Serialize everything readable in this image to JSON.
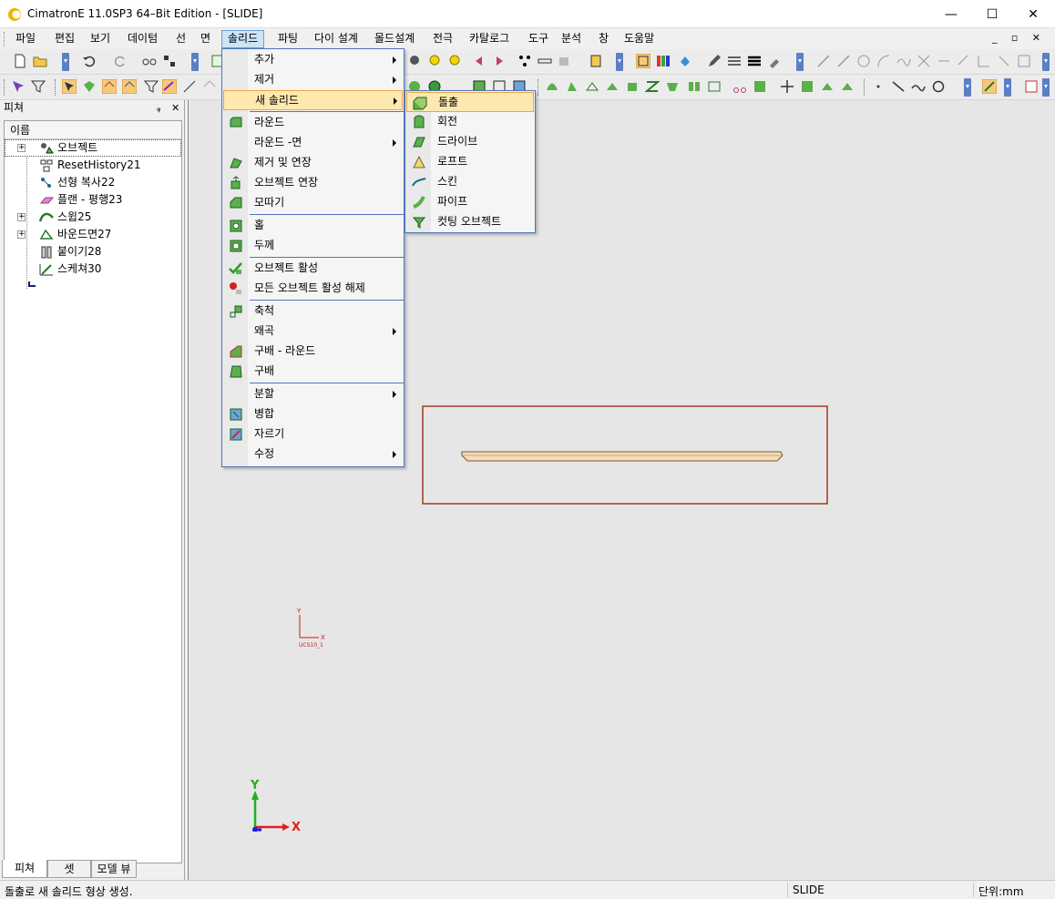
{
  "window": {
    "title": "CimatronE 11.0SP3 64–Bit Edition - [SLIDE]",
    "minimize_glyph": "—",
    "maximize_glyph": "☐",
    "close_glyph": "✕"
  },
  "menubar": {
    "items": [
      "파일",
      "편집",
      "보기",
      "데이텀",
      "선",
      "면",
      "솔리드",
      "파팅",
      "다이 설계",
      "몰드설계",
      "전극",
      "카탈로그",
      "도구",
      "분석",
      "창",
      "도움말"
    ],
    "active_index": 6,
    "mdi_controls": "_ ▫ ✕"
  },
  "feature_panel": {
    "title": "피쳐",
    "pin_glyph": "ᵩ",
    "close_glyph": "✕",
    "column_header": "이름",
    "tree": [
      {
        "label": "오브젝트",
        "expander": "+",
        "icon": "objects-icon"
      },
      {
        "label": "ResetHistory21",
        "icon": "reset-history-icon"
      },
      {
        "label": "선형 복사22",
        "icon": "linear-copy-icon"
      },
      {
        "label": "플랜 - 평행23",
        "icon": "plane-icon"
      },
      {
        "label": "스윕25",
        "expander": "+",
        "icon": "sweep-icon"
      },
      {
        "label": "바운드면27",
        "expander": "+",
        "icon": "bounded-face-icon"
      },
      {
        "label": "붙이기28",
        "icon": "attach-icon"
      },
      {
        "label": "스케쳐30",
        "icon": "sketcher-icon"
      }
    ],
    "tabs": [
      "피쳐",
      "셋",
      "모델 뷰"
    ],
    "active_tab": 0
  },
  "solid_menu": {
    "groups": [
      [
        {
          "label": "추가",
          "submenu": true
        },
        {
          "label": "제거",
          "submenu": true
        },
        {
          "label": "새 솔리드",
          "submenu": true,
          "highlight": true
        }
      ],
      [
        {
          "label": "라운드",
          "icon": "round-icon"
        },
        {
          "label": "라운드 -면",
          "submenu": true
        },
        {
          "label": "제거 및 연장",
          "icon": "remove-extend-icon"
        },
        {
          "label": "오브젝트 연장",
          "icon": "object-extend-icon"
        },
        {
          "label": "모따기",
          "icon": "chamfer-icon"
        }
      ],
      [
        {
          "label": "홀",
          "icon": "hole-icon"
        },
        {
          "label": "두께",
          "icon": "thickness-icon"
        }
      ],
      [
        {
          "label": "오브젝트 활성",
          "icon": "activate-object-icon"
        },
        {
          "label": "모든 오브젝트 활성 해제",
          "icon": "deactivate-all-icon"
        }
      ],
      [
        {
          "label": "축척",
          "icon": "scale-icon"
        },
        {
          "label": "왜곡",
          "submenu": true
        },
        {
          "label": "구배 - 라운드",
          "icon": "draft-round-icon"
        },
        {
          "label": "구배",
          "icon": "draft-icon"
        }
      ],
      [
        {
          "label": "분할",
          "submenu": true
        },
        {
          "label": "병합",
          "icon": "merge-icon"
        },
        {
          "label": "자르기",
          "icon": "cut-icon"
        },
        {
          "label": "수정",
          "submenu": true
        }
      ]
    ]
  },
  "new_solid_submenu": {
    "items": [
      {
        "label": "돌출",
        "icon": "extrude-icon",
        "highlight": true
      },
      {
        "label": "회전",
        "icon": "revolve-icon"
      },
      {
        "label": "드라이브",
        "icon": "drive-icon"
      },
      {
        "label": "로프트",
        "icon": "loft-icon"
      },
      {
        "label": "스킨",
        "icon": "skin-icon"
      },
      {
        "label": "파이프",
        "icon": "pipe-icon"
      },
      {
        "label": "컷팅 오브젝트",
        "icon": "cutting-object-icon"
      }
    ]
  },
  "viewport": {
    "ucs_label": "UCS10_1",
    "small_axis_y": "Y",
    "small_axis_x": "X",
    "axis_y": "Y",
    "axis_x": "X",
    "colors": {
      "frame": "#a33a1a",
      "part": "#f6dcb8",
      "axis_x": "#e02020",
      "axis_y": "#20b020",
      "axis_z": "#2020e0"
    }
  },
  "statusbar": {
    "message": "돌출로 새 솔리드 형상 생성.",
    "document": "SLIDE",
    "units": "단위:mm"
  }
}
